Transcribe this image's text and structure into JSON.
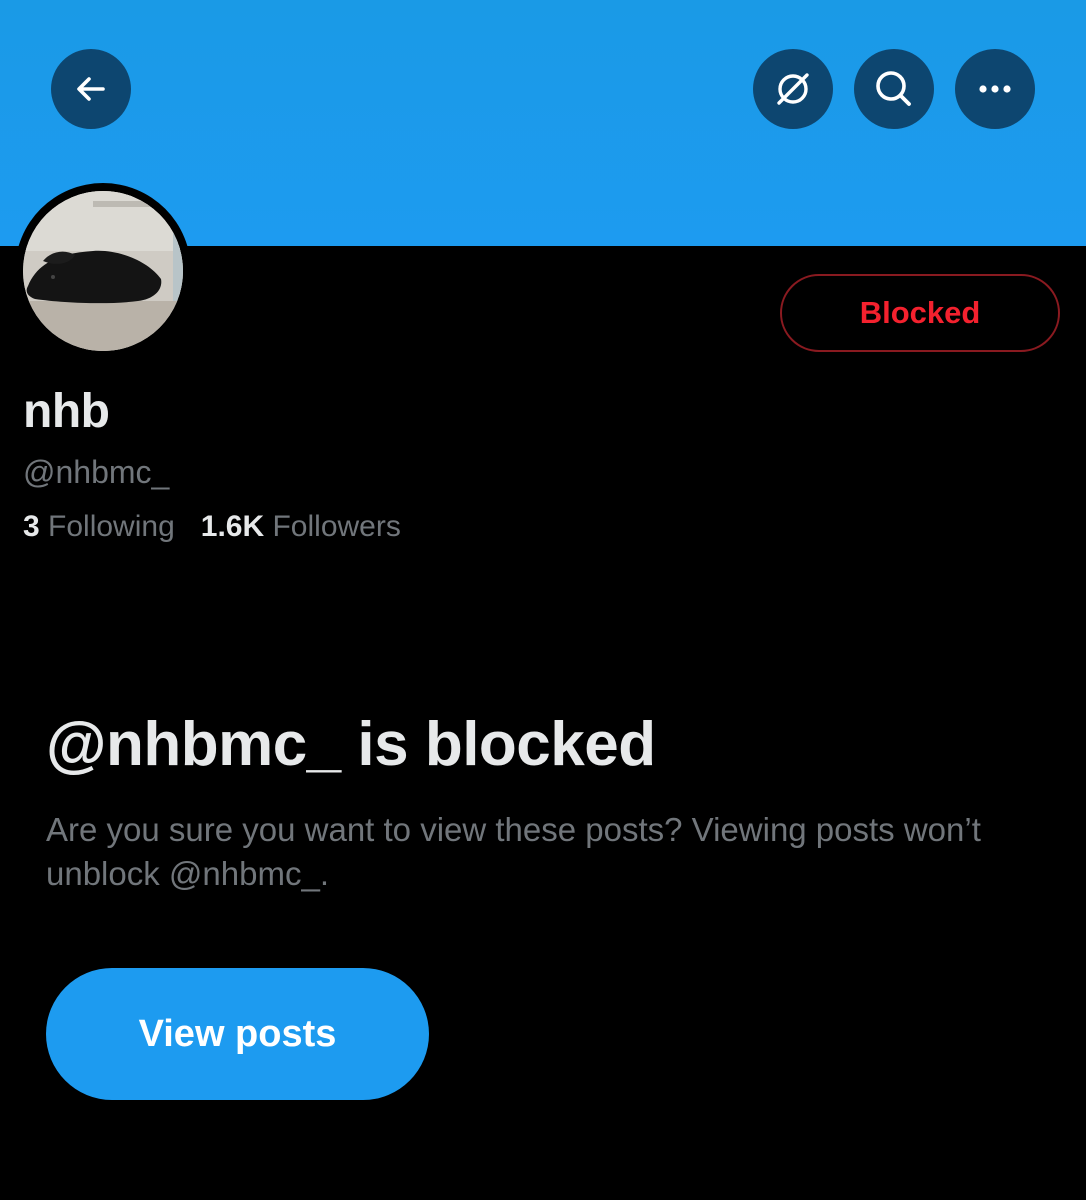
{
  "header": {
    "back_icon": "arrow-left-icon",
    "translate_icon": "translate-slash-icon",
    "search_icon": "search-icon",
    "more_icon": "more-horizontal-icon",
    "banner_color": "#1d9bf0",
    "button_bg_color": "#0d4670"
  },
  "profile": {
    "display_name": "nhb",
    "handle": "@nhbmc_",
    "blocked_button_label": "Blocked",
    "blocked_color": "#f4212e",
    "following_count": "3",
    "following_label": "Following",
    "followers_count": "1.6K",
    "followers_label": "Followers"
  },
  "blocked_notice": {
    "title": "@nhbmc_ is blocked",
    "description": "Are you sure you want to view these posts? Viewing posts won’t unblock @nhbmc_.",
    "view_posts_label": "View posts",
    "accent_color": "#1d9bf0"
  }
}
